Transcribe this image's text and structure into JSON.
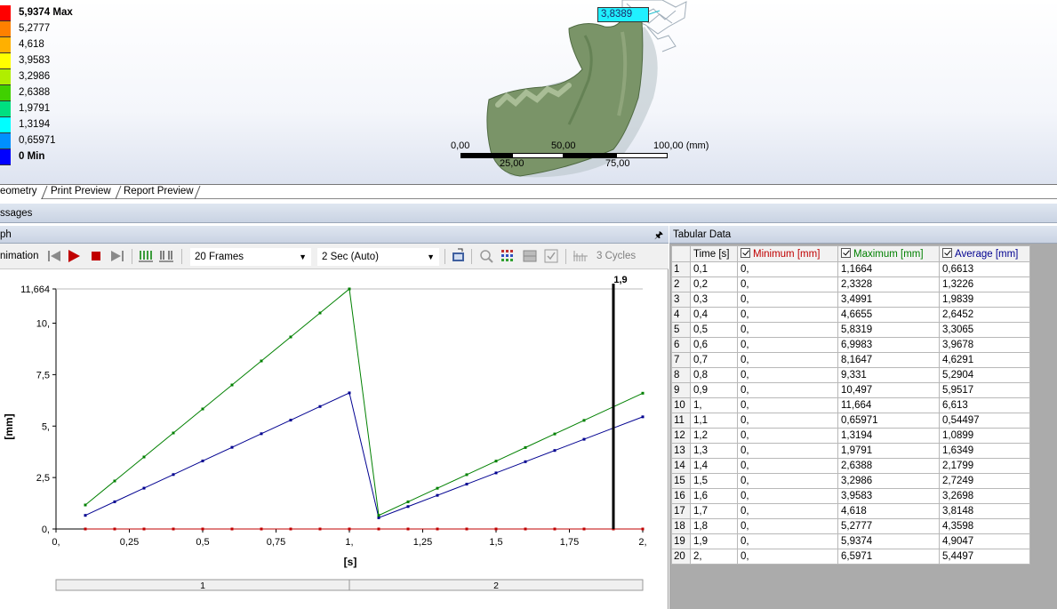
{
  "legend": {
    "items": [
      {
        "label": "5,9374 Max",
        "color": "#ff0000",
        "bold": true
      },
      {
        "label": "5,2777",
        "color": "#ff8000"
      },
      {
        "label": "4,618",
        "color": "#ffb000"
      },
      {
        "label": "3,9583",
        "color": "#ffff00"
      },
      {
        "label": "3,2986",
        "color": "#b0ee00"
      },
      {
        "label": "2,6388",
        "color": "#40d000"
      },
      {
        "label": "1,9791",
        "color": "#00e080"
      },
      {
        "label": "1,3194",
        "color": "#00ffff"
      },
      {
        "label": "0,65971",
        "color": "#0090ff"
      },
      {
        "label": "0 Min",
        "color": "#0000ff",
        "bold": true
      }
    ]
  },
  "probe": {
    "value": "3,8389"
  },
  "scale": {
    "top": [
      "0,00",
      "50,00",
      "100,00 (mm)"
    ],
    "bottom": [
      "25,00",
      "75,00"
    ]
  },
  "tabs": {
    "geometry": "eometry",
    "print_preview": "Print Preview",
    "report_preview": "Report Preview"
  },
  "messages": {
    "title": "ssages"
  },
  "graph": {
    "title": "ph",
    "animation_label": "nimation",
    "frames": "20 Frames",
    "duration": "2 Sec (Auto)",
    "cycles": "3 Cycles"
  },
  "chart_data": {
    "type": "line",
    "xlabel": "[s]",
    "ylabel": "[mm]",
    "xlim": [
      0,
      2
    ],
    "ylim": [
      0,
      11.664
    ],
    "x_ticks": [
      0,
      0.25,
      0.5,
      0.75,
      1,
      1.25,
      1.5,
      1.75,
      2
    ],
    "x_tick_labels": [
      "0,",
      "0,25",
      "0,5",
      "0,75",
      "1,",
      "1,25",
      "1,5",
      "1,75",
      "2,"
    ],
    "y_ticks": [
      0,
      2.5,
      5,
      7.5,
      10,
      11.664
    ],
    "y_tick_labels": [
      "0,",
      "2,5",
      "5,",
      "7,5",
      "10,",
      "11,664"
    ],
    "cursor": {
      "x": 1.9,
      "label": "1,9"
    },
    "steps": [
      "1",
      "2"
    ],
    "x": [
      0.1,
      0.2,
      0.3,
      0.4,
      0.5,
      0.6,
      0.7,
      0.8,
      0.9,
      1.0,
      1.1,
      1.2,
      1.3,
      1.4,
      1.5,
      1.6,
      1.7,
      1.8,
      1.9,
      2.0
    ],
    "series": [
      {
        "key": "minimum",
        "color": "#c00000",
        "values": [
          0,
          0,
          0,
          0,
          0,
          0,
          0,
          0,
          0,
          0,
          0,
          0,
          0,
          0,
          0,
          0,
          0,
          0,
          0,
          0
        ]
      },
      {
        "key": "maximum",
        "color": "#008000",
        "values": [
          1.1664,
          2.3328,
          3.4991,
          4.6655,
          5.8319,
          6.9983,
          8.1647,
          9.331,
          10.497,
          11.664,
          0.65971,
          1.3194,
          1.9791,
          2.6388,
          3.2986,
          3.9583,
          4.618,
          5.2777,
          5.9374,
          6.5971
        ]
      },
      {
        "key": "average",
        "color": "#000090",
        "values": [
          0.6613,
          1.3226,
          1.9839,
          2.6452,
          3.3065,
          3.9678,
          4.6291,
          5.2904,
          5.9517,
          6.613,
          0.54497,
          1.0899,
          1.6349,
          2.1799,
          2.7249,
          3.2698,
          3.8148,
          4.3598,
          4.9047,
          5.4497
        ]
      }
    ]
  },
  "tabular": {
    "title": "Tabular Data",
    "headers": {
      "time": "Time [s]",
      "minimum": "Minimum [mm]",
      "maximum": "Maximum [mm]",
      "average": "Average [mm]"
    },
    "header_colors": {
      "minimum": "#c00000",
      "maximum": "#008000",
      "average": "#000090"
    },
    "rows": [
      [
        "1",
        "0,1",
        "0,",
        "1,1664",
        "0,6613"
      ],
      [
        "2",
        "0,2",
        "0,",
        "2,3328",
        "1,3226"
      ],
      [
        "3",
        "0,3",
        "0,",
        "3,4991",
        "1,9839"
      ],
      [
        "4",
        "0,4",
        "0,",
        "4,6655",
        "2,6452"
      ],
      [
        "5",
        "0,5",
        "0,",
        "5,8319",
        "3,3065"
      ],
      [
        "6",
        "0,6",
        "0,",
        "6,9983",
        "3,9678"
      ],
      [
        "7",
        "0,7",
        "0,",
        "8,1647",
        "4,6291"
      ],
      [
        "8",
        "0,8",
        "0,",
        "9,331",
        "5,2904"
      ],
      [
        "9",
        "0,9",
        "0,",
        "10,497",
        "5,9517"
      ],
      [
        "10",
        "1,",
        "0,",
        "11,664",
        "6,613"
      ],
      [
        "11",
        "1,1",
        "0,",
        "0,65971",
        "0,54497"
      ],
      [
        "12",
        "1,2",
        "0,",
        "1,3194",
        "1,0899"
      ],
      [
        "13",
        "1,3",
        "0,",
        "1,9791",
        "1,6349"
      ],
      [
        "14",
        "1,4",
        "0,",
        "2,6388",
        "2,1799"
      ],
      [
        "15",
        "1,5",
        "0,",
        "3,2986",
        "2,7249"
      ],
      [
        "16",
        "1,6",
        "0,",
        "3,9583",
        "3,2698"
      ],
      [
        "17",
        "1,7",
        "0,",
        "4,618",
        "3,8148"
      ],
      [
        "18",
        "1,8",
        "0,",
        "5,2777",
        "4,3598"
      ],
      [
        "19",
        "1,9",
        "0,",
        "5,9374",
        "4,9047"
      ],
      [
        "20",
        "2,",
        "0,",
        "6,5971",
        "5,4497"
      ]
    ]
  }
}
